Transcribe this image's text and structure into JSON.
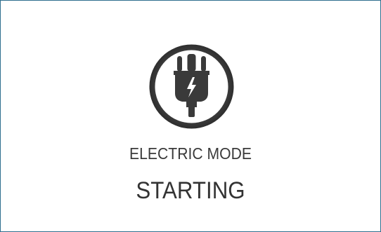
{
  "screen": {
    "mode_label": "ELECTRIC MODE",
    "status_label": "STARTING",
    "icon": "electric-plug-icon"
  },
  "colors": {
    "border": "#2f6f8f",
    "ring": "#383838",
    "text": "#333333",
    "background": "#ffffff"
  }
}
